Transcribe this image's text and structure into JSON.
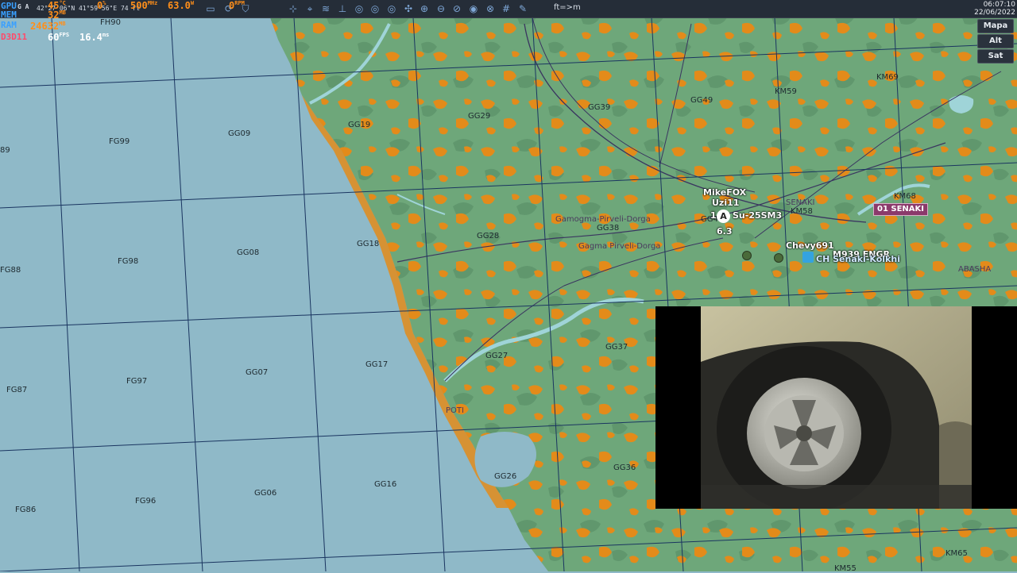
{
  "overlay": {
    "gpu_label": "GPU",
    "gpu_temp": "45",
    "gpu_temp_unit": "°C",
    "gpu_load": "0",
    "gpu_load_unit": "%",
    "gpu_clock": "500",
    "gpu_clock_unit": "MHz",
    "gpu_power": "63.0",
    "gpu_power_unit": "W",
    "gpu_fan": "0",
    "gpu_fan_unit": "RPM",
    "mem_label": "MEM",
    "mem_value": "32",
    "mem_unit": "MB",
    "ram_label": "RAM",
    "ram_value": "24632",
    "ram_unit": "MB",
    "api_label": "D3D11",
    "fps_value": "60",
    "fps_unit": "FPS",
    "frametime_value": "16.4",
    "frametime_unit": "ms",
    "coords_prefix": "G A",
    "coords": "42°27'06\"N 41°59'56\"E  74 ft"
  },
  "toolbar": {
    "units_toggle": "ft=>m",
    "icons": [
      "screen-icon",
      "refresh-icon",
      "filter-icon",
      "target-icon",
      "wifi-icon",
      "ruler-icon",
      "layer1-icon",
      "layer2-icon",
      "layer3-icon",
      "layer4-icon",
      "layer5-icon",
      "zoom-in-icon",
      "zoom-out-icon",
      "zoom-reset-icon",
      "radar-icon",
      "globe-icon",
      "grid-icon",
      "pen-icon"
    ]
  },
  "clock": {
    "time": "06:07:10",
    "date": "22/06/2022"
  },
  "map_buttons": [
    "Mapa",
    "Alt",
    "Sat"
  ],
  "grid_labels": [
    "FH90",
    "FG99",
    "GG09",
    "GG19",
    "GG29",
    "GG39",
    "GG49",
    "KM59",
    "KM69",
    "FG88",
    "FG98",
    "GG08",
    "GG18",
    "GG28",
    "GG38",
    "KM58",
    "KM68",
    "FG87",
    "FG97",
    "GG07",
    "GG17",
    "GG27",
    "GG37",
    "FG86",
    "FG96",
    "GG06",
    "GG16",
    "GG26",
    "GG36",
    "KM55",
    "KM65",
    "89",
    "GG48"
  ],
  "town_labels": [
    "Gamogma-Pirveli-Dorga",
    "Gagma Pirveli-Dorga",
    "SENAKI",
    "ABASHA",
    "POTI"
  ],
  "units": {
    "flight_name": "MikeFOX",
    "callsign": "Uzi11",
    "aircraft_index": "1",
    "aircraft_marker": "A",
    "aircraft_type": "Su-25SM3",
    "aircraft_speed": "6.3",
    "ground_unit": "Chevy691",
    "ground_unit_2": "M939 ENGR",
    "airbase": "CH Senaki-Kolkhi",
    "airbase_tag": "01 SENAKI"
  },
  "colors": {
    "sea": "#8fb9c8",
    "land": "#6ea77a",
    "urban": "#e38b1a",
    "grid_line": "#1a3560",
    "river": "#9fd4d8",
    "toolbar": "#252d38",
    "overlay_label": "#3aa0ff",
    "overlay_value": "#ff8f1a",
    "airbase_badge": "#8b3a6b"
  }
}
